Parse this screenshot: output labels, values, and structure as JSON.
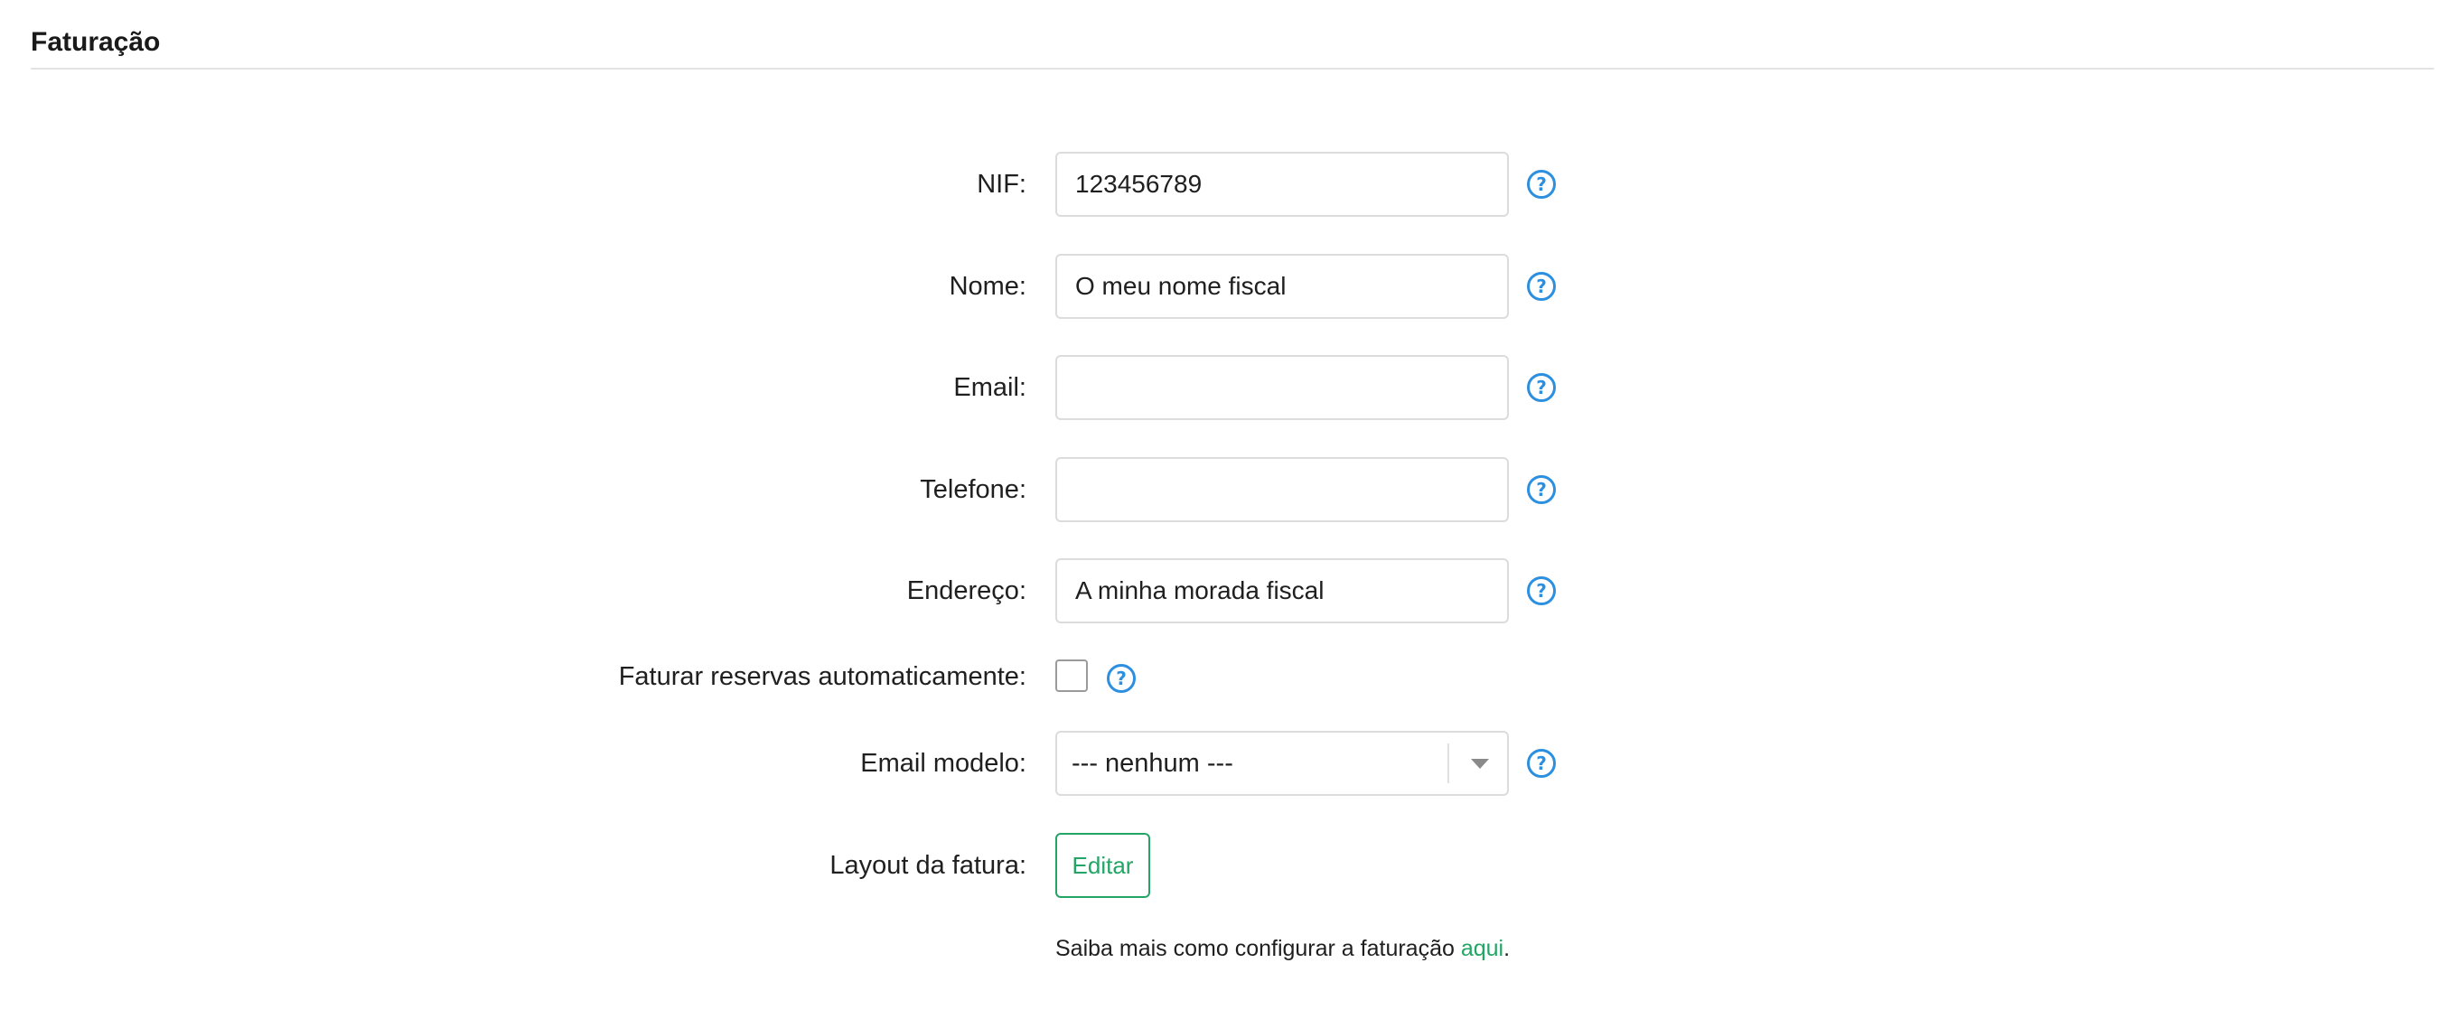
{
  "section": {
    "title": "Faturação"
  },
  "form": {
    "nif": {
      "label": "NIF:",
      "value": "123456789"
    },
    "nome": {
      "label": "Nome:",
      "value": "O meu nome fiscal"
    },
    "email": {
      "label": "Email:",
      "value": ""
    },
    "telefone": {
      "label": "Telefone:",
      "value": ""
    },
    "endereco": {
      "label": "Endereço:",
      "value": "A minha morada fiscal"
    },
    "auto_invoice": {
      "label": "Faturar reservas automaticamente:",
      "checked": false
    },
    "email_template": {
      "label": "Email modelo:",
      "selected": "--- nenhum ---"
    },
    "invoice_layout": {
      "label": "Layout da fatura:",
      "button_label": "Editar"
    }
  },
  "help_icon_glyph": "?",
  "footer_note": {
    "text": "Saiba mais como configurar a faturação ",
    "link_text": "aqui",
    "suffix": "."
  },
  "colors": {
    "accent_green": "#22a565",
    "help_blue": "#2d8fe0",
    "border_gray": "#dcdcdc"
  }
}
